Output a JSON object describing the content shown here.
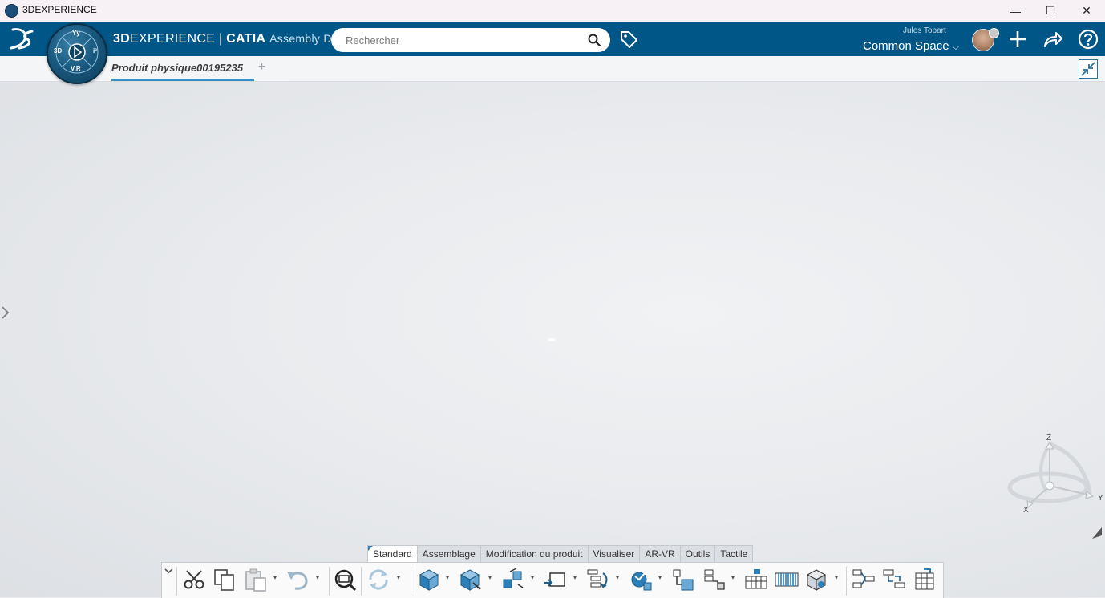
{
  "window": {
    "title": "3DEXPERIENCE",
    "controls": [
      "—",
      "☐",
      "✕"
    ]
  },
  "header": {
    "brand_bold": "3D",
    "brand_rest": "EXPERIENCE",
    "brand_sep": " | ",
    "brand_product": "CATIA",
    "app_name": "Assembly De...",
    "search_placeholder": "Rechercher",
    "user_name": "Jules Topart",
    "space": "Common Space",
    "compass_labels": {
      "top": "Yy",
      "left": "3D",
      "right": "i³",
      "bottom": "V.R"
    }
  },
  "tabs": {
    "document": "Produit physique00195235",
    "add": "+"
  },
  "action_sections": [
    "Standard",
    "Assemblage",
    "Modification du produit",
    "Visualiser",
    "AR-VR",
    "Outils",
    "Tactile"
  ],
  "active_section": "Standard",
  "compass3d": {
    "z": "Z",
    "x": "X",
    "y": "Y"
  },
  "icons": [
    "cut-icon",
    "copy-icon",
    "paste-icon",
    "undo-icon",
    "zoom-icon",
    "update-icon",
    "insert-product-icon",
    "new-part-icon",
    "explode-icon",
    "replace-icon",
    "reorder-icon",
    "engineering-connection-icon",
    "constraint-icon",
    "fix-icon",
    "pattern-icon",
    "section-icon",
    "cube-view-icon",
    "sync-structure-icon",
    "compare-structure-icon",
    "table-icon"
  ],
  "colors": {
    "topbar": "#005686",
    "accent": "#368ec4",
    "icon_blue": "#2d7fb8"
  }
}
